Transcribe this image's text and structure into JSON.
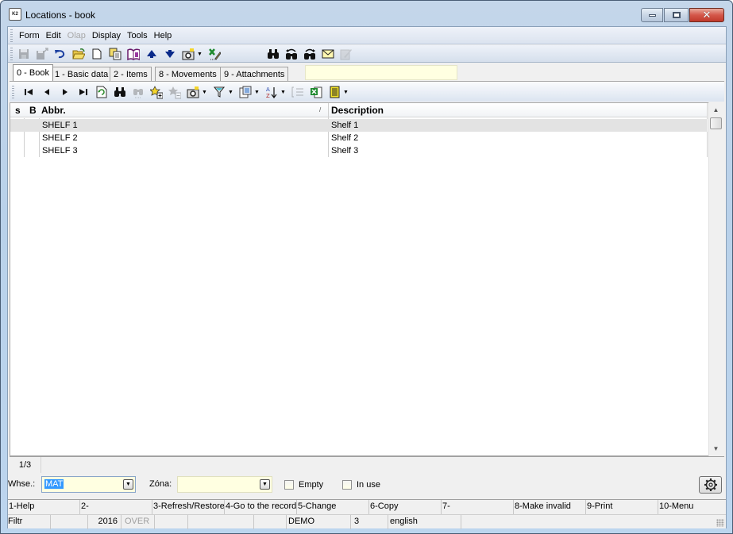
{
  "window": {
    "title": "Locations - book",
    "app_icon": "K2",
    "controls": {
      "minimize": "minimize-icon",
      "maximize": "maximize-icon",
      "close": "close-icon"
    }
  },
  "menubar": {
    "items": [
      {
        "label": "Form",
        "enabled": true
      },
      {
        "label": "Edit",
        "enabled": true
      },
      {
        "label": "Olap",
        "enabled": false
      },
      {
        "label": "Display",
        "enabled": true
      },
      {
        "label": "Tools",
        "enabled": true
      },
      {
        "label": "Help",
        "enabled": true
      }
    ]
  },
  "toolbar_main": {
    "icons": [
      "save-icon",
      "save-as-icon",
      "undo-icon",
      "open-folder-icon",
      "new-document-icon",
      "copy-icon",
      "book-icon",
      "arrow-up-icon",
      "arrow-down-icon",
      "camera-icon",
      "dropdown-icon",
      "excel-export-icon",
      "find-icon",
      "find-previous-icon",
      "find-next-icon",
      "mail-icon",
      "notes-icon"
    ]
  },
  "tabs": [
    {
      "label": "0 - Book",
      "active": true
    },
    {
      "label": "1 - Basic data",
      "active": false
    },
    {
      "label": "2 - Items",
      "active": false
    },
    {
      "label": "8 - Movements",
      "active": false
    },
    {
      "label": "9 - Attachments",
      "active": false
    }
  ],
  "toolbar_grid": {
    "icons": [
      "first-record-icon",
      "previous-record-icon",
      "next-record-icon",
      "last-record-icon",
      "refresh-icon",
      "find-icon",
      "find-disabled-icon",
      "add-to-selection-icon",
      "remove-from-selection-icon",
      "camera-icon",
      "filter-icon",
      "column-setup-icon",
      "sort-icon",
      "outline-icon",
      "excel-icon",
      "report-icon"
    ]
  },
  "grid": {
    "columns": [
      {
        "key": "s",
        "label": "s"
      },
      {
        "key": "b",
        "label": "B"
      },
      {
        "key": "abbr",
        "label": "Abbr.",
        "sort": "/"
      },
      {
        "key": "description",
        "label": "Description"
      }
    ],
    "rows": [
      {
        "s": "",
        "b": "",
        "abbr": "SHELF 1",
        "description": "Shelf 1",
        "selected": true
      },
      {
        "s": "",
        "b": "",
        "abbr": "SHELF 2",
        "description": "Shelf 2",
        "selected": false
      },
      {
        "s": "",
        "b": "",
        "abbr": "SHELF 3",
        "description": "Shelf 3",
        "selected": false
      }
    ],
    "record_counter": "1/3"
  },
  "filter": {
    "whse_label": "Whse.:",
    "whse_value": "MAT",
    "zona_label": "Zóna:",
    "zona_value": "",
    "empty_label": "Empty",
    "empty_checked": false,
    "in_use_label": "In use",
    "in_use_checked": false,
    "settings_icon": "gear-icon"
  },
  "function_keys": [
    "1-Help",
    "2-",
    "3-Refresh/Restore",
    "4-Go to the record",
    "5-Change",
    "6-Copy",
    "7-",
    "8-Make invalid",
    "9-Print",
    "10-Menu"
  ],
  "statusbar": {
    "filter": "Filtr",
    "blank1": "",
    "year": "2016",
    "mode": "OVER",
    "blank2": "",
    "blank3": "",
    "blank4": "",
    "database": "DEMO",
    "number": "3",
    "language": "english"
  }
}
